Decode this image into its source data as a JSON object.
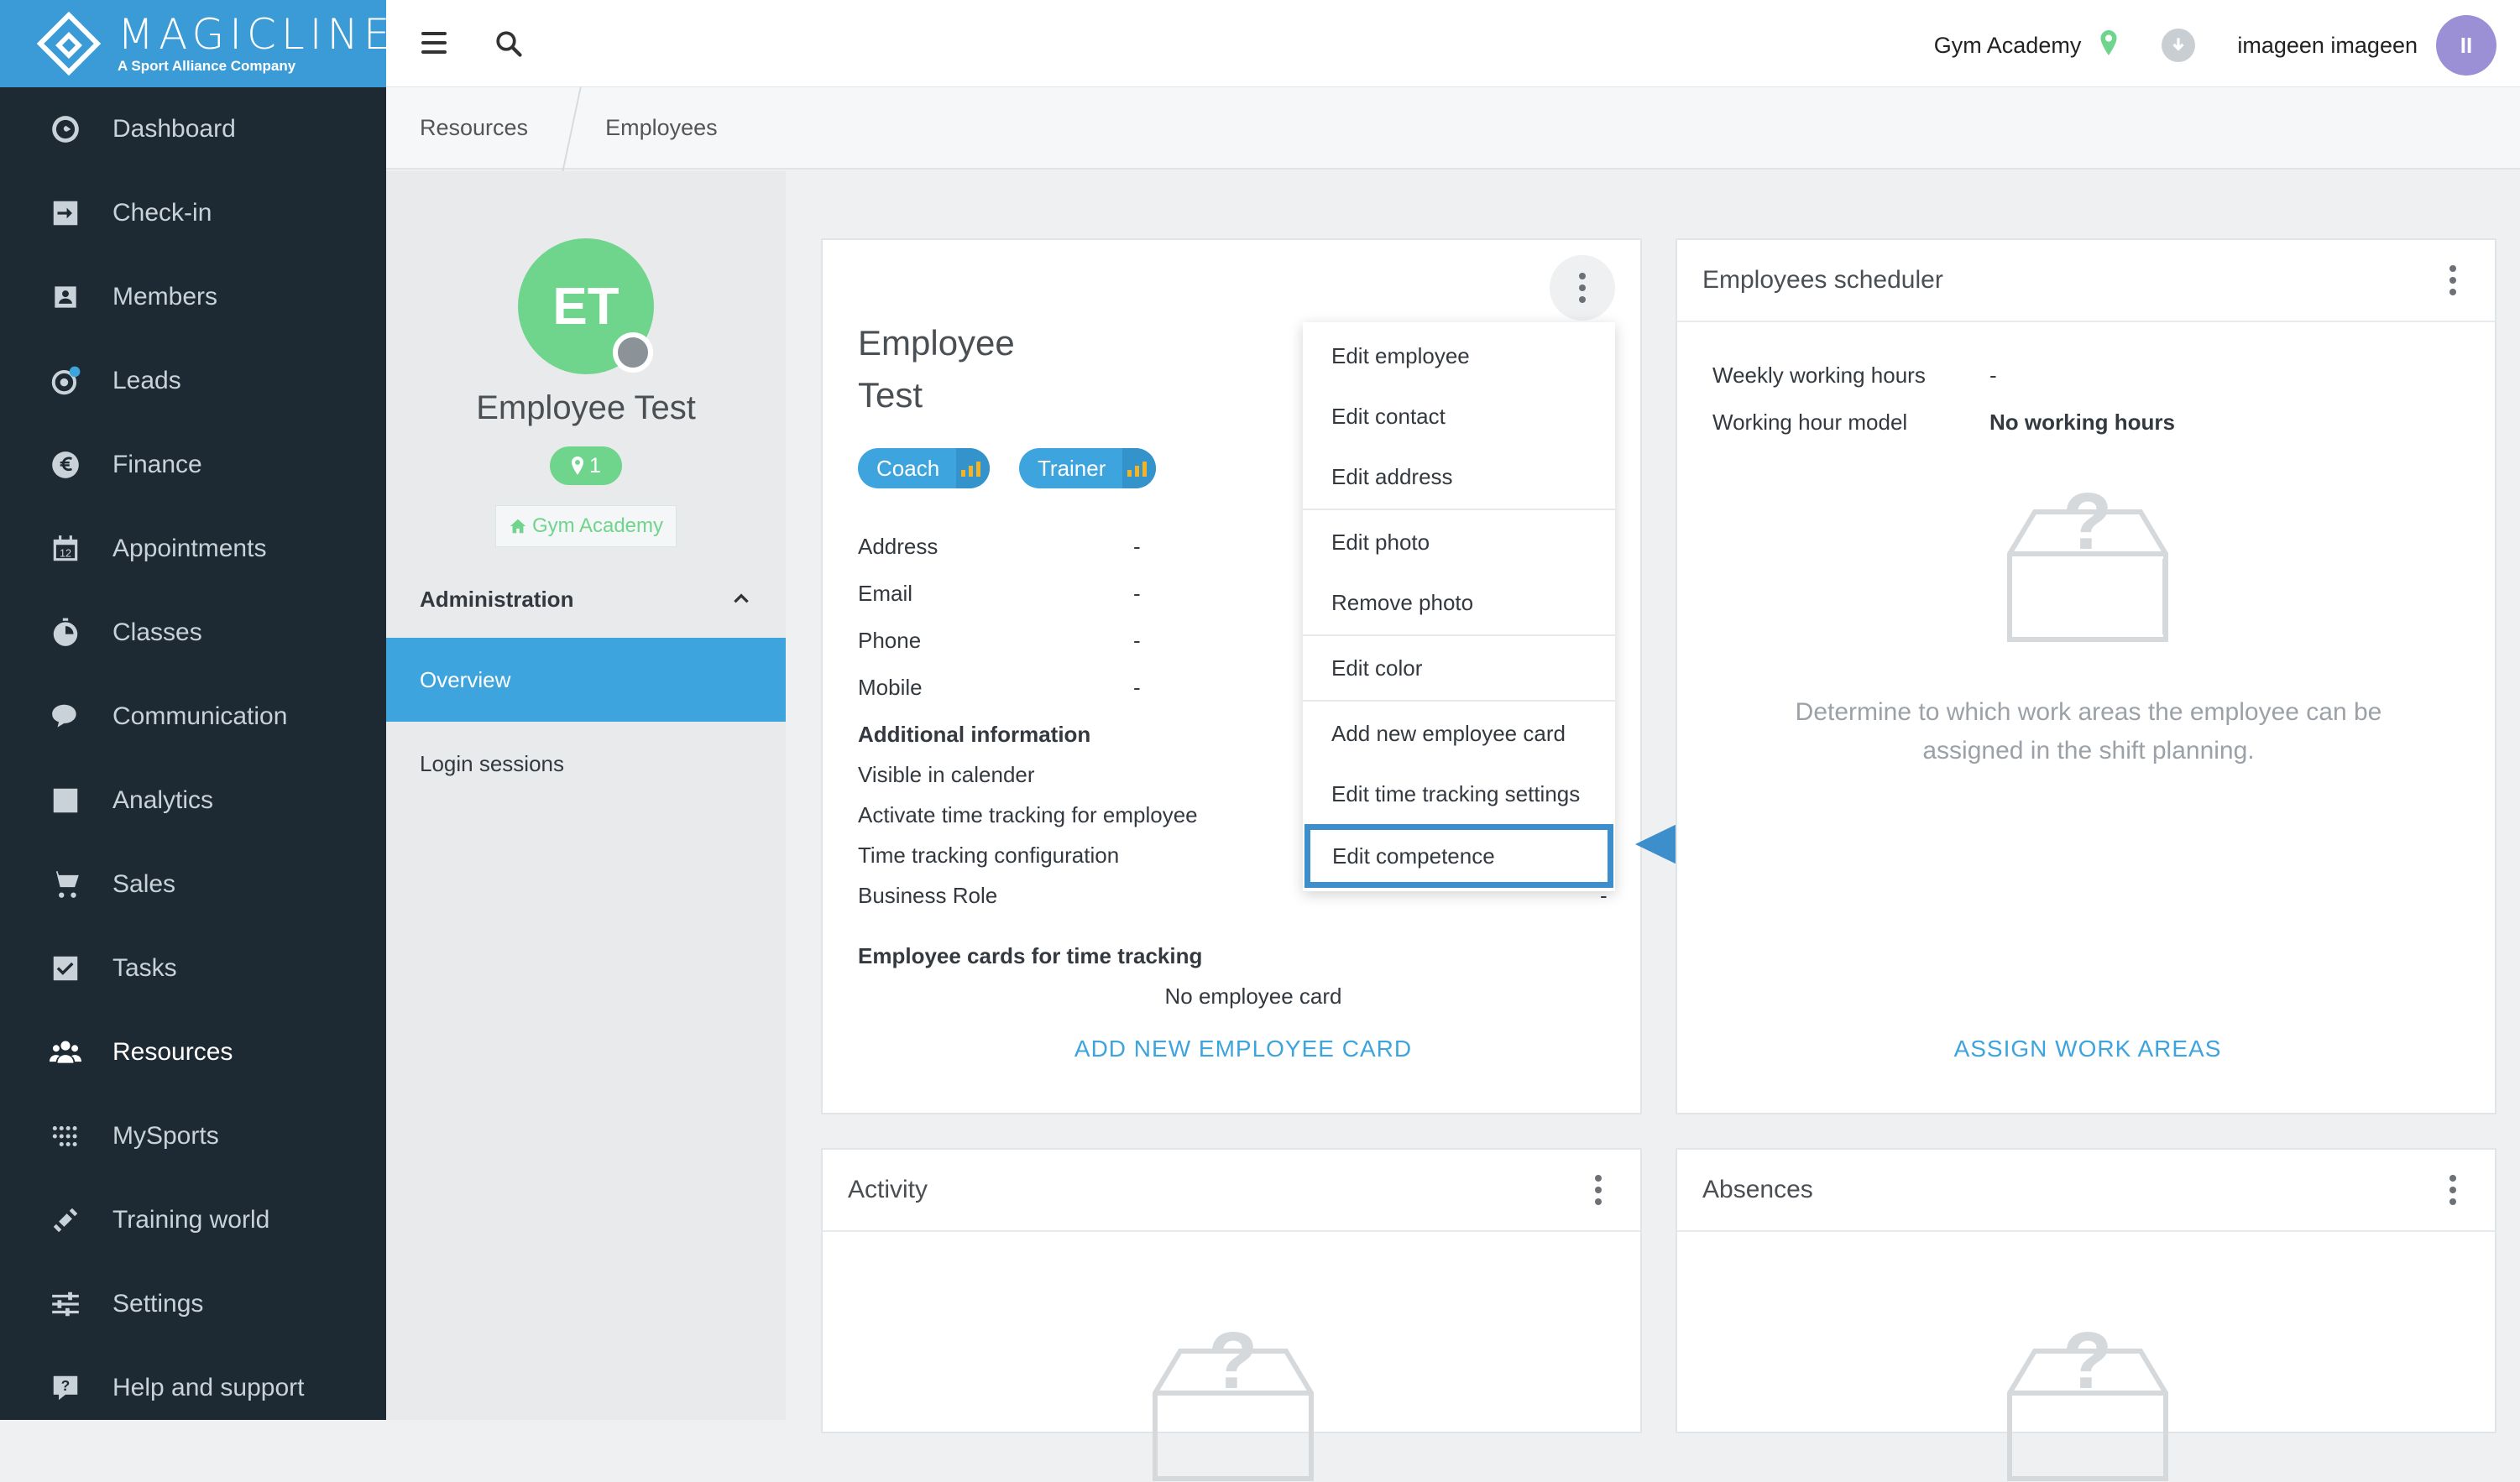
{
  "brand": {
    "name": "MAGICLINE",
    "sub": "A Sport Alliance Company"
  },
  "nav": [
    {
      "label": "Dashboard",
      "icon": "dashboard-icon"
    },
    {
      "label": "Check-in",
      "icon": "check-in-icon"
    },
    {
      "label": "Members",
      "icon": "members-icon"
    },
    {
      "label": "Leads",
      "icon": "leads-icon"
    },
    {
      "label": "Finance",
      "icon": "euro-icon"
    },
    {
      "label": "Appointments",
      "icon": "calendar-icon"
    },
    {
      "label": "Classes",
      "icon": "stopwatch-icon"
    },
    {
      "label": "Communication",
      "icon": "chat-icon"
    },
    {
      "label": "Analytics",
      "icon": "chart-icon"
    },
    {
      "label": "Sales",
      "icon": "cart-icon"
    },
    {
      "label": "Tasks",
      "icon": "checkbox-icon"
    },
    {
      "label": "Resources",
      "icon": "people-icon",
      "active": true
    },
    {
      "label": "MySports",
      "icon": "dots-grid-icon"
    },
    {
      "label": "Training world",
      "icon": "dumbbell-icon"
    },
    {
      "label": "Settings",
      "icon": "sliders-icon"
    },
    {
      "label": "Help and support",
      "icon": "help-icon"
    }
  ],
  "topbar": {
    "studio": "Gym Academy",
    "user": "imageen imageen",
    "avatar_initials": "II"
  },
  "breadcrumb": [
    "Resources",
    "Employees"
  ],
  "profile": {
    "initials": "ET",
    "name": "Employee Test",
    "badge_count": "1",
    "studio": "Gym Academy",
    "section": "Administration",
    "menu": [
      "Overview",
      "Login sessions"
    ]
  },
  "employee_card": {
    "first_name": "Employee",
    "last_name": "Test",
    "roles": [
      "Coach",
      "Trainer"
    ],
    "fields": [
      {
        "label": "Address",
        "value": "-"
      },
      {
        "label": "Email",
        "value": "-"
      },
      {
        "label": "Phone",
        "value": "-"
      },
      {
        "label": "Mobile",
        "value": "-"
      }
    ],
    "additional_title": "Additional information",
    "additional": [
      "Visible in calender",
      "Activate time tracking for employee",
      "Time tracking configuration",
      "Business Role"
    ],
    "business_role_value": "-",
    "cards_title": "Employee cards for time tracking",
    "no_card": "No employee card",
    "add_card_link": "ADD NEW EMPLOYEE CARD"
  },
  "dropdown": [
    "Edit employee",
    "Edit contact",
    "Edit address",
    "Edit photo",
    "Remove photo",
    "Edit color",
    "Add new employee card",
    "Edit time tracking settings",
    "Edit competence"
  ],
  "scheduler": {
    "title": "Employees scheduler",
    "weekly_label": "Weekly working hours",
    "weekly_value": "-",
    "model_label": "Working hour model",
    "model_value": "No working hours",
    "description": "Determine to which work areas the employee can be assigned in the shift planning.",
    "link": "ASSIGN WORK AREAS"
  },
  "activity": {
    "title": "Activity"
  },
  "absences": {
    "title": "Absences"
  }
}
